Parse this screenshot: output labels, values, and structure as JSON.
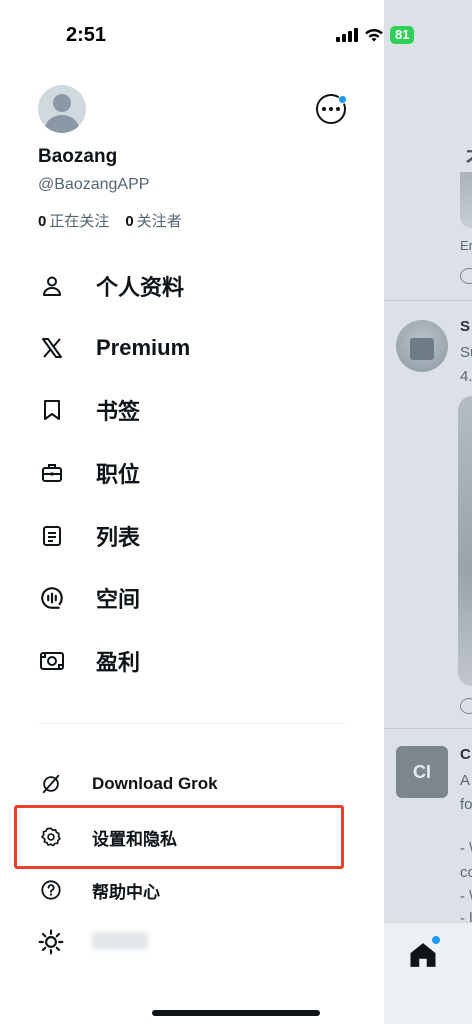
{
  "status_bar": {
    "time": "2:51",
    "battery": "81"
  },
  "profile": {
    "display_name": "Baozang",
    "handle": "@BaozangAPP",
    "following_count": "0",
    "following_label": "正在关注",
    "followers_count": "0",
    "followers_label": "关注者"
  },
  "menu": {
    "items": [
      {
        "label": "个人资料",
        "icon": "person-icon"
      },
      {
        "label": "Premium",
        "icon": "x-logo-icon"
      },
      {
        "label": "书签",
        "icon": "bookmark-icon"
      },
      {
        "label": "职位",
        "icon": "briefcase-icon"
      },
      {
        "label": "列表",
        "icon": "list-icon"
      },
      {
        "label": "空间",
        "icon": "spaces-icon"
      },
      {
        "label": "盈利",
        "icon": "monetization-icon"
      }
    ]
  },
  "secondary_menu": {
    "items": [
      {
        "label": "Download Grok",
        "icon": "grok-icon"
      },
      {
        "label": "设置和隐私",
        "icon": "gear-icon"
      },
      {
        "label": "帮助中心",
        "icon": "help-icon"
      }
    ]
  },
  "theme_toggle": {
    "icon": "sun-icon"
  },
  "background_feed": {
    "fragments": [
      "S",
      "Su",
      "4.",
      "Er",
      "C",
      "A",
      "fo",
      "- \\",
      "co",
      "- \\",
      "- l"
    ],
    "logo_text": "CI"
  },
  "colors": {
    "accent": "#1d9bf0",
    "highlight": "#e8402a",
    "battery": "#30d158"
  }
}
